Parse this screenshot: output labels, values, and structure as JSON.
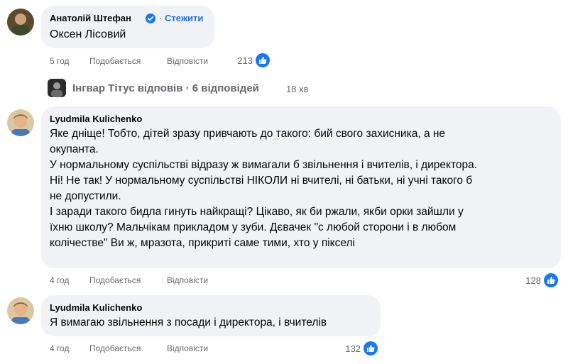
{
  "comment1": {
    "author": "Анатолій Штефан",
    "follow_label": "Стежити",
    "text": "Оксен Лісовий",
    "time": "5 год",
    "like_label": "Подобається",
    "reply_label": "Відповісти",
    "reactions": "213"
  },
  "replies_link": {
    "label": "Інгвар Тітус відповів · 6 відповідей",
    "time": "18 хв"
  },
  "comment2": {
    "author": "Lyudmila Kulichenko",
    "lines": [
      "Яке дніще! Тобто, дітей зразу привчають до такого: бий свого захисника, а не",
      "окупанта.",
      "У нормальному суспільстві відразу ж вимагали б звільнення і вчителів, і директора.",
      "Ні! Не так! У нормальному суспільстві НІКОЛИ ні вчителі, ні батьки, ні учні такого б",
      "не допустили.",
      "І заради такого бидла гинуть найкращі? Цікаво, як би ржали, якби орки зайшли у",
      "їхню школу? Мальчікам прикладом у зуби. Дєвачек \"с любой сторони і в любом",
      "колічестве\" Ви ж, мразота, прикриті саме тими, хто у пікселі"
    ],
    "time": "4 год",
    "like_label": "Подобається",
    "reply_label": "Відповісти",
    "reactions": "128"
  },
  "comment3": {
    "author": "Lyudmila Kulichenko",
    "text": "Я вимагаю звільнення з посади і директора, і вчителів",
    "time": "4 год",
    "like_label": "Подобається",
    "reply_label": "Відповісти",
    "reactions": "132"
  },
  "colors": {
    "bubble": "#f0f2f5",
    "link_blue": "#216fdb",
    "like_blue": "#1877f2",
    "meta_gray": "#65676b"
  },
  "icons": [
    "verified-badge-icon",
    "like-icon"
  ]
}
